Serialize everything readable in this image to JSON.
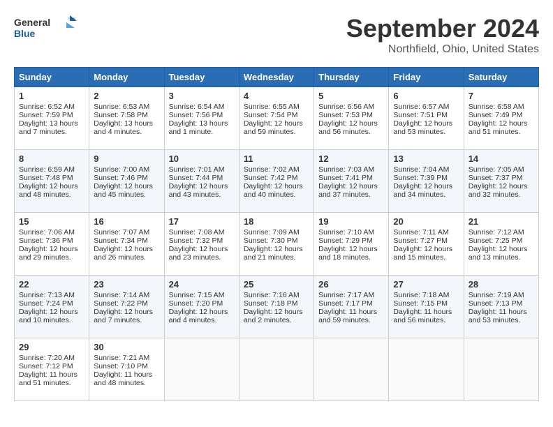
{
  "header": {
    "logo_general": "General",
    "logo_blue": "Blue",
    "month_title": "September 2024",
    "location": "Northfield, Ohio, United States"
  },
  "days_of_week": [
    "Sunday",
    "Monday",
    "Tuesday",
    "Wednesday",
    "Thursday",
    "Friday",
    "Saturday"
  ],
  "weeks": [
    [
      {
        "day": "1",
        "sunrise": "6:52 AM",
        "sunset": "7:59 PM",
        "daylight": "13 hours and 7 minutes."
      },
      {
        "day": "2",
        "sunrise": "6:53 AM",
        "sunset": "7:58 PM",
        "daylight": "13 hours and 4 minutes."
      },
      {
        "day": "3",
        "sunrise": "6:54 AM",
        "sunset": "7:56 PM",
        "daylight": "13 hours and 1 minute."
      },
      {
        "day": "4",
        "sunrise": "6:55 AM",
        "sunset": "7:54 PM",
        "daylight": "12 hours and 59 minutes."
      },
      {
        "day": "5",
        "sunrise": "6:56 AM",
        "sunset": "7:53 PM",
        "daylight": "12 hours and 56 minutes."
      },
      {
        "day": "6",
        "sunrise": "6:57 AM",
        "sunset": "7:51 PM",
        "daylight": "12 hours and 53 minutes."
      },
      {
        "day": "7",
        "sunrise": "6:58 AM",
        "sunset": "7:49 PM",
        "daylight": "12 hours and 51 minutes."
      }
    ],
    [
      {
        "day": "8",
        "sunrise": "6:59 AM",
        "sunset": "7:48 PM",
        "daylight": "12 hours and 48 minutes."
      },
      {
        "day": "9",
        "sunrise": "7:00 AM",
        "sunset": "7:46 PM",
        "daylight": "12 hours and 45 minutes."
      },
      {
        "day": "10",
        "sunrise": "7:01 AM",
        "sunset": "7:44 PM",
        "daylight": "12 hours and 43 minutes."
      },
      {
        "day": "11",
        "sunrise": "7:02 AM",
        "sunset": "7:42 PM",
        "daylight": "12 hours and 40 minutes."
      },
      {
        "day": "12",
        "sunrise": "7:03 AM",
        "sunset": "7:41 PM",
        "daylight": "12 hours and 37 minutes."
      },
      {
        "day": "13",
        "sunrise": "7:04 AM",
        "sunset": "7:39 PM",
        "daylight": "12 hours and 34 minutes."
      },
      {
        "day": "14",
        "sunrise": "7:05 AM",
        "sunset": "7:37 PM",
        "daylight": "12 hours and 32 minutes."
      }
    ],
    [
      {
        "day": "15",
        "sunrise": "7:06 AM",
        "sunset": "7:36 PM",
        "daylight": "12 hours and 29 minutes."
      },
      {
        "day": "16",
        "sunrise": "7:07 AM",
        "sunset": "7:34 PM",
        "daylight": "12 hours and 26 minutes."
      },
      {
        "day": "17",
        "sunrise": "7:08 AM",
        "sunset": "7:32 PM",
        "daylight": "12 hours and 23 minutes."
      },
      {
        "day": "18",
        "sunrise": "7:09 AM",
        "sunset": "7:30 PM",
        "daylight": "12 hours and 21 minutes."
      },
      {
        "day": "19",
        "sunrise": "7:10 AM",
        "sunset": "7:29 PM",
        "daylight": "12 hours and 18 minutes."
      },
      {
        "day": "20",
        "sunrise": "7:11 AM",
        "sunset": "7:27 PM",
        "daylight": "12 hours and 15 minutes."
      },
      {
        "day": "21",
        "sunrise": "7:12 AM",
        "sunset": "7:25 PM",
        "daylight": "12 hours and 13 minutes."
      }
    ],
    [
      {
        "day": "22",
        "sunrise": "7:13 AM",
        "sunset": "7:24 PM",
        "daylight": "12 hours and 10 minutes."
      },
      {
        "day": "23",
        "sunrise": "7:14 AM",
        "sunset": "7:22 PM",
        "daylight": "12 hours and 7 minutes."
      },
      {
        "day": "24",
        "sunrise": "7:15 AM",
        "sunset": "7:20 PM",
        "daylight": "12 hours and 4 minutes."
      },
      {
        "day": "25",
        "sunrise": "7:16 AM",
        "sunset": "7:18 PM",
        "daylight": "12 hours and 2 minutes."
      },
      {
        "day": "26",
        "sunrise": "7:17 AM",
        "sunset": "7:17 PM",
        "daylight": "11 hours and 59 minutes."
      },
      {
        "day": "27",
        "sunrise": "7:18 AM",
        "sunset": "7:15 PM",
        "daylight": "11 hours and 56 minutes."
      },
      {
        "day": "28",
        "sunrise": "7:19 AM",
        "sunset": "7:13 PM",
        "daylight": "11 hours and 53 minutes."
      }
    ],
    [
      {
        "day": "29",
        "sunrise": "7:20 AM",
        "sunset": "7:12 PM",
        "daylight": "11 hours and 51 minutes."
      },
      {
        "day": "30",
        "sunrise": "7:21 AM",
        "sunset": "7:10 PM",
        "daylight": "11 hours and 48 minutes."
      },
      null,
      null,
      null,
      null,
      null
    ]
  ]
}
